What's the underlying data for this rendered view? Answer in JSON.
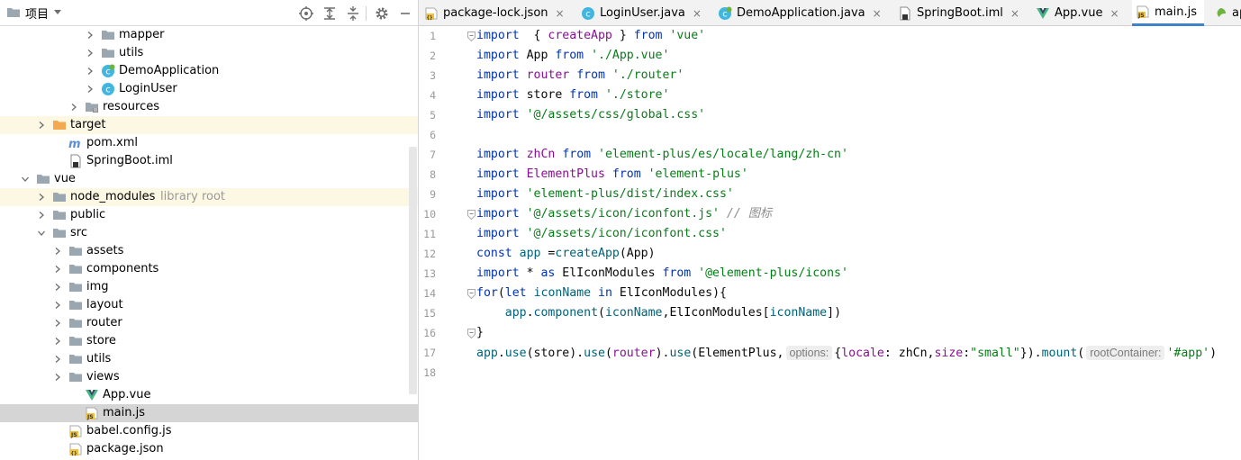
{
  "project_panel": {
    "title": "项目"
  },
  "tree": [
    {
      "label": "mapper",
      "kind": "folder",
      "indent": 4,
      "arrow": true
    },
    {
      "label": "utils",
      "kind": "folder",
      "indent": 4,
      "arrow": true
    },
    {
      "label": "DemoApplication",
      "kind": "class-spring",
      "indent": 4,
      "arrow": true
    },
    {
      "label": "LoginUser",
      "kind": "class",
      "indent": 4,
      "arrow": true
    },
    {
      "label": "resources",
      "kind": "folder-res",
      "indent": 3,
      "arrow": true
    },
    {
      "label": "target",
      "kind": "folder-orange",
      "indent": 1,
      "arrow": true,
      "highlight": true
    },
    {
      "label": "pom.xml",
      "kind": "maven",
      "indent": 2,
      "arrow": false
    },
    {
      "label": "SpringBoot.iml",
      "kind": "iml",
      "indent": 2,
      "arrow": false
    },
    {
      "label": "vue",
      "kind": "folder",
      "indent": 0,
      "arrow": true,
      "open": true
    },
    {
      "label": "node_modules",
      "hint": "library root",
      "kind": "folder",
      "indent": 1,
      "arrow": true,
      "highlight": true
    },
    {
      "label": "public",
      "kind": "folder",
      "indent": 1,
      "arrow": true
    },
    {
      "label": "src",
      "kind": "folder",
      "indent": 1,
      "arrow": true,
      "open": true
    },
    {
      "label": "assets",
      "kind": "folder",
      "indent": 2,
      "arrow": true
    },
    {
      "label": "components",
      "kind": "folder",
      "indent": 2,
      "arrow": true
    },
    {
      "label": "img",
      "kind": "folder",
      "indent": 2,
      "arrow": true
    },
    {
      "label": "layout",
      "kind": "folder",
      "indent": 2,
      "arrow": true
    },
    {
      "label": "router",
      "kind": "folder",
      "indent": 2,
      "arrow": true
    },
    {
      "label": "store",
      "kind": "folder",
      "indent": 2,
      "arrow": true
    },
    {
      "label": "utils",
      "kind": "folder",
      "indent": 2,
      "arrow": true
    },
    {
      "label": "views",
      "kind": "folder",
      "indent": 2,
      "arrow": true
    },
    {
      "label": "App.vue",
      "kind": "vue",
      "indent": 3,
      "arrow": false
    },
    {
      "label": "main.js",
      "kind": "js",
      "indent": 3,
      "arrow": false,
      "selected": true
    },
    {
      "label": "babel.config.js",
      "kind": "js",
      "indent": 2,
      "arrow": false
    },
    {
      "label": "package.json",
      "kind": "json",
      "indent": 2,
      "arrow": false
    }
  ],
  "tabs": [
    {
      "label": "package-lock.json",
      "icon": "json-file-icon",
      "close": true
    },
    {
      "label": "LoginUser.java",
      "icon": "java-class-icon",
      "close": true
    },
    {
      "label": "DemoApplication.java",
      "icon": "spring-class-icon",
      "close": true
    },
    {
      "label": "SpringBoot.iml",
      "icon": "iml-file-icon",
      "close": true
    },
    {
      "label": "App.vue",
      "icon": "vue-file-icon",
      "close": true
    },
    {
      "label": "main.js",
      "icon": "js-file-icon",
      "close": false,
      "active": true
    },
    {
      "label": "application.prop",
      "icon": "spring-config-icon",
      "close": false
    }
  ],
  "line_numbers": [
    "1",
    "2",
    "3",
    "4",
    "5",
    "6",
    "7",
    "8",
    "9",
    "10",
    "11",
    "12",
    "13",
    "14",
    "15",
    "16",
    "17",
    "18"
  ],
  "code_lines": [
    [
      [
        "kw",
        "import"
      ],
      [
        "",
        "  { "
      ],
      [
        "vr",
        "createApp"
      ],
      [
        "",
        " } "
      ],
      [
        "kw",
        "from"
      ],
      [
        "",
        " "
      ],
      [
        "st",
        "'vue'"
      ]
    ],
    [
      [
        "kw",
        "import"
      ],
      [
        "",
        " App "
      ],
      [
        "kw",
        "from"
      ],
      [
        "",
        " "
      ],
      [
        "st",
        "'./App.vue'"
      ]
    ],
    [
      [
        "kw",
        "import"
      ],
      [
        "",
        " "
      ],
      [
        "vr",
        "router"
      ],
      [
        "",
        " "
      ],
      [
        "kw",
        "from"
      ],
      [
        "",
        " "
      ],
      [
        "st",
        "'./router'"
      ]
    ],
    [
      [
        "kw",
        "import"
      ],
      [
        "",
        " store "
      ],
      [
        "kw",
        "from"
      ],
      [
        "",
        " "
      ],
      [
        "st",
        "'./store'"
      ]
    ],
    [
      [
        "kw",
        "import"
      ],
      [
        "",
        " "
      ],
      [
        "st",
        "'@/assets/css/global.css'"
      ]
    ],
    [],
    [
      [
        "kw",
        "import"
      ],
      [
        "",
        " "
      ],
      [
        "vr",
        "zhCn"
      ],
      [
        "",
        " "
      ],
      [
        "kw",
        "from"
      ],
      [
        "",
        " "
      ],
      [
        "st",
        "'element-plus/es/locale/lang/zh-cn'"
      ]
    ],
    [
      [
        "kw",
        "import"
      ],
      [
        "",
        " "
      ],
      [
        "vr",
        "ElementPlus"
      ],
      [
        "",
        " "
      ],
      [
        "kw",
        "from"
      ],
      [
        "",
        " "
      ],
      [
        "st",
        "'element-plus'"
      ]
    ],
    [
      [
        "kw",
        "import"
      ],
      [
        "",
        " "
      ],
      [
        "st",
        "'element-plus/dist/index.css'"
      ]
    ],
    [
      [
        "kw",
        "import"
      ],
      [
        "",
        " "
      ],
      [
        "st",
        "'@/assets/icon/iconfont.js'"
      ],
      [
        "",
        " "
      ],
      [
        "cm",
        "// 图标"
      ]
    ],
    [
      [
        "kw",
        "import"
      ],
      [
        "",
        " "
      ],
      [
        "st",
        "'@/assets/icon/iconfont.css'"
      ]
    ],
    [
      [
        "kw",
        "const"
      ],
      [
        "",
        " "
      ],
      [
        "fn",
        "app"
      ],
      [
        "",
        " ="
      ],
      [
        "fn",
        "createApp"
      ],
      [
        "",
        "(App)"
      ]
    ],
    [
      [
        "kw",
        "import"
      ],
      [
        "",
        " * "
      ],
      [
        "kw",
        "as"
      ],
      [
        "",
        " ElIconModules "
      ],
      [
        "kw",
        "from"
      ],
      [
        "",
        " "
      ],
      [
        "st",
        "'@element-plus/icons'"
      ]
    ],
    [
      [
        "kw",
        "for"
      ],
      [
        "",
        "("
      ],
      [
        "kw",
        "let"
      ],
      [
        "",
        " "
      ],
      [
        "fn",
        "iconName"
      ],
      [
        "",
        " "
      ],
      [
        "kw",
        "in"
      ],
      [
        "",
        " ElIconModules){"
      ]
    ],
    [
      [
        "",
        "    "
      ],
      [
        "fn",
        "app"
      ],
      [
        "",
        "."
      ],
      [
        "fn",
        "component"
      ],
      [
        "",
        "("
      ],
      [
        "fn",
        "iconName"
      ],
      [
        "",
        ",ElIconModules["
      ],
      [
        "fn",
        "iconName"
      ],
      [
        "",
        "])"
      ]
    ],
    [
      [
        "",
        "}"
      ]
    ],
    [
      [
        "fn",
        "app"
      ],
      [
        "",
        "."
      ],
      [
        "fn",
        "use"
      ],
      [
        "",
        "(store)."
      ],
      [
        "fn",
        "use"
      ],
      [
        "",
        "("
      ],
      [
        "vr",
        "router"
      ],
      [
        "",
        ")."
      ],
      [
        "fn",
        "use"
      ],
      [
        "",
        "(ElementPlus,"
      ],
      [
        "inlay",
        "options:"
      ],
      [
        "",
        "{"
      ],
      [
        "vr",
        "locale"
      ],
      [
        "",
        ": zhCn,"
      ],
      [
        "vr",
        "size"
      ],
      [
        "",
        ":"
      ],
      [
        "st",
        "\"small\""
      ],
      [
        "",
        "})."
      ],
      [
        "fn",
        "mount"
      ],
      [
        "",
        "("
      ],
      [
        "inlay",
        "rootContainer:"
      ],
      [
        "",
        ""
      ],
      [
        "st",
        "'#app'"
      ],
      [
        "",
        ")"
      ]
    ],
    []
  ],
  "colors": {
    "accent": "#4083c9",
    "keyword": "#0033b3",
    "string": "#067d17",
    "selection": "#d5d5d5"
  }
}
